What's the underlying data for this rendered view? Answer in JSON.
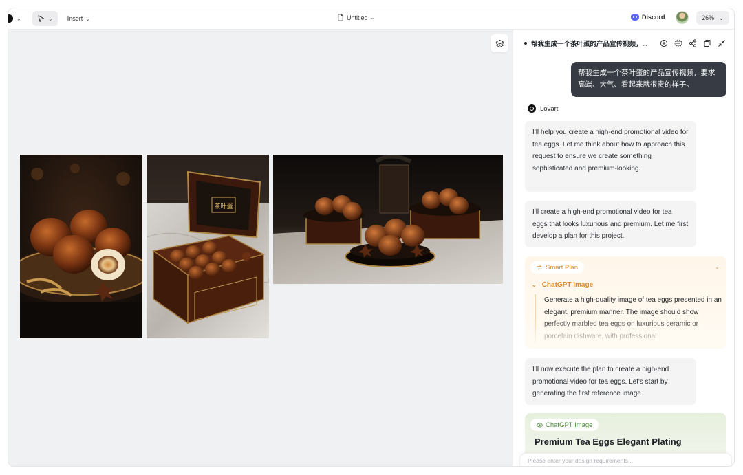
{
  "toolbar": {
    "insert_label": "Insert",
    "document_title": "Untitled",
    "discord_label": "Discord",
    "zoom_level": "26%"
  },
  "canvas": {
    "images": [
      {
        "name": "tea-eggs-plate-image"
      },
      {
        "name": "tea-eggs-gift-box-image"
      },
      {
        "name": "tea-eggs-banquet-image"
      }
    ],
    "box_label": "茶叶蛋"
  },
  "chat": {
    "title": "帮我生成一个茶叶蛋的产品宣传视频，...",
    "user_message": "帮我生成一个茶叶蛋的产品宣传视频，要求高端、大气、看起来就很贵的样子。",
    "sender_name": "Lovart",
    "messages": [
      "I'll help you create a high-end promotional video for tea eggs. Let me think about how to approach this request to ensure we create something sophisticated and premium-looking.",
      "I'll create a high-end promotional video for tea eggs that looks luxurious and premium. Let me first develop a plan for this project.",
      "I'll now execute the plan to create a high-end promotional video for tea eggs. Let's start by generating the first reference image."
    ],
    "smart_plan": {
      "chip_label": "Smart Plan",
      "step_label": "ChatGPT Image",
      "step_text": "Generate a high-quality image of tea eggs presented in an elegant, premium manner. The image should show perfectly marbled tea eggs on luxurious ceramic or porcelain dishware, with professional"
    },
    "generation": {
      "chip_label": "ChatGPT Image",
      "title": "Premium Tea Eggs Elegant Plating"
    },
    "input_placeholder": "Please enter your design requirements..."
  },
  "colors": {
    "accent_orange": "#d98a2a",
    "accent_green": "#4c8a3a",
    "user_bubble": "#373c44",
    "discord": "#5865f2"
  }
}
